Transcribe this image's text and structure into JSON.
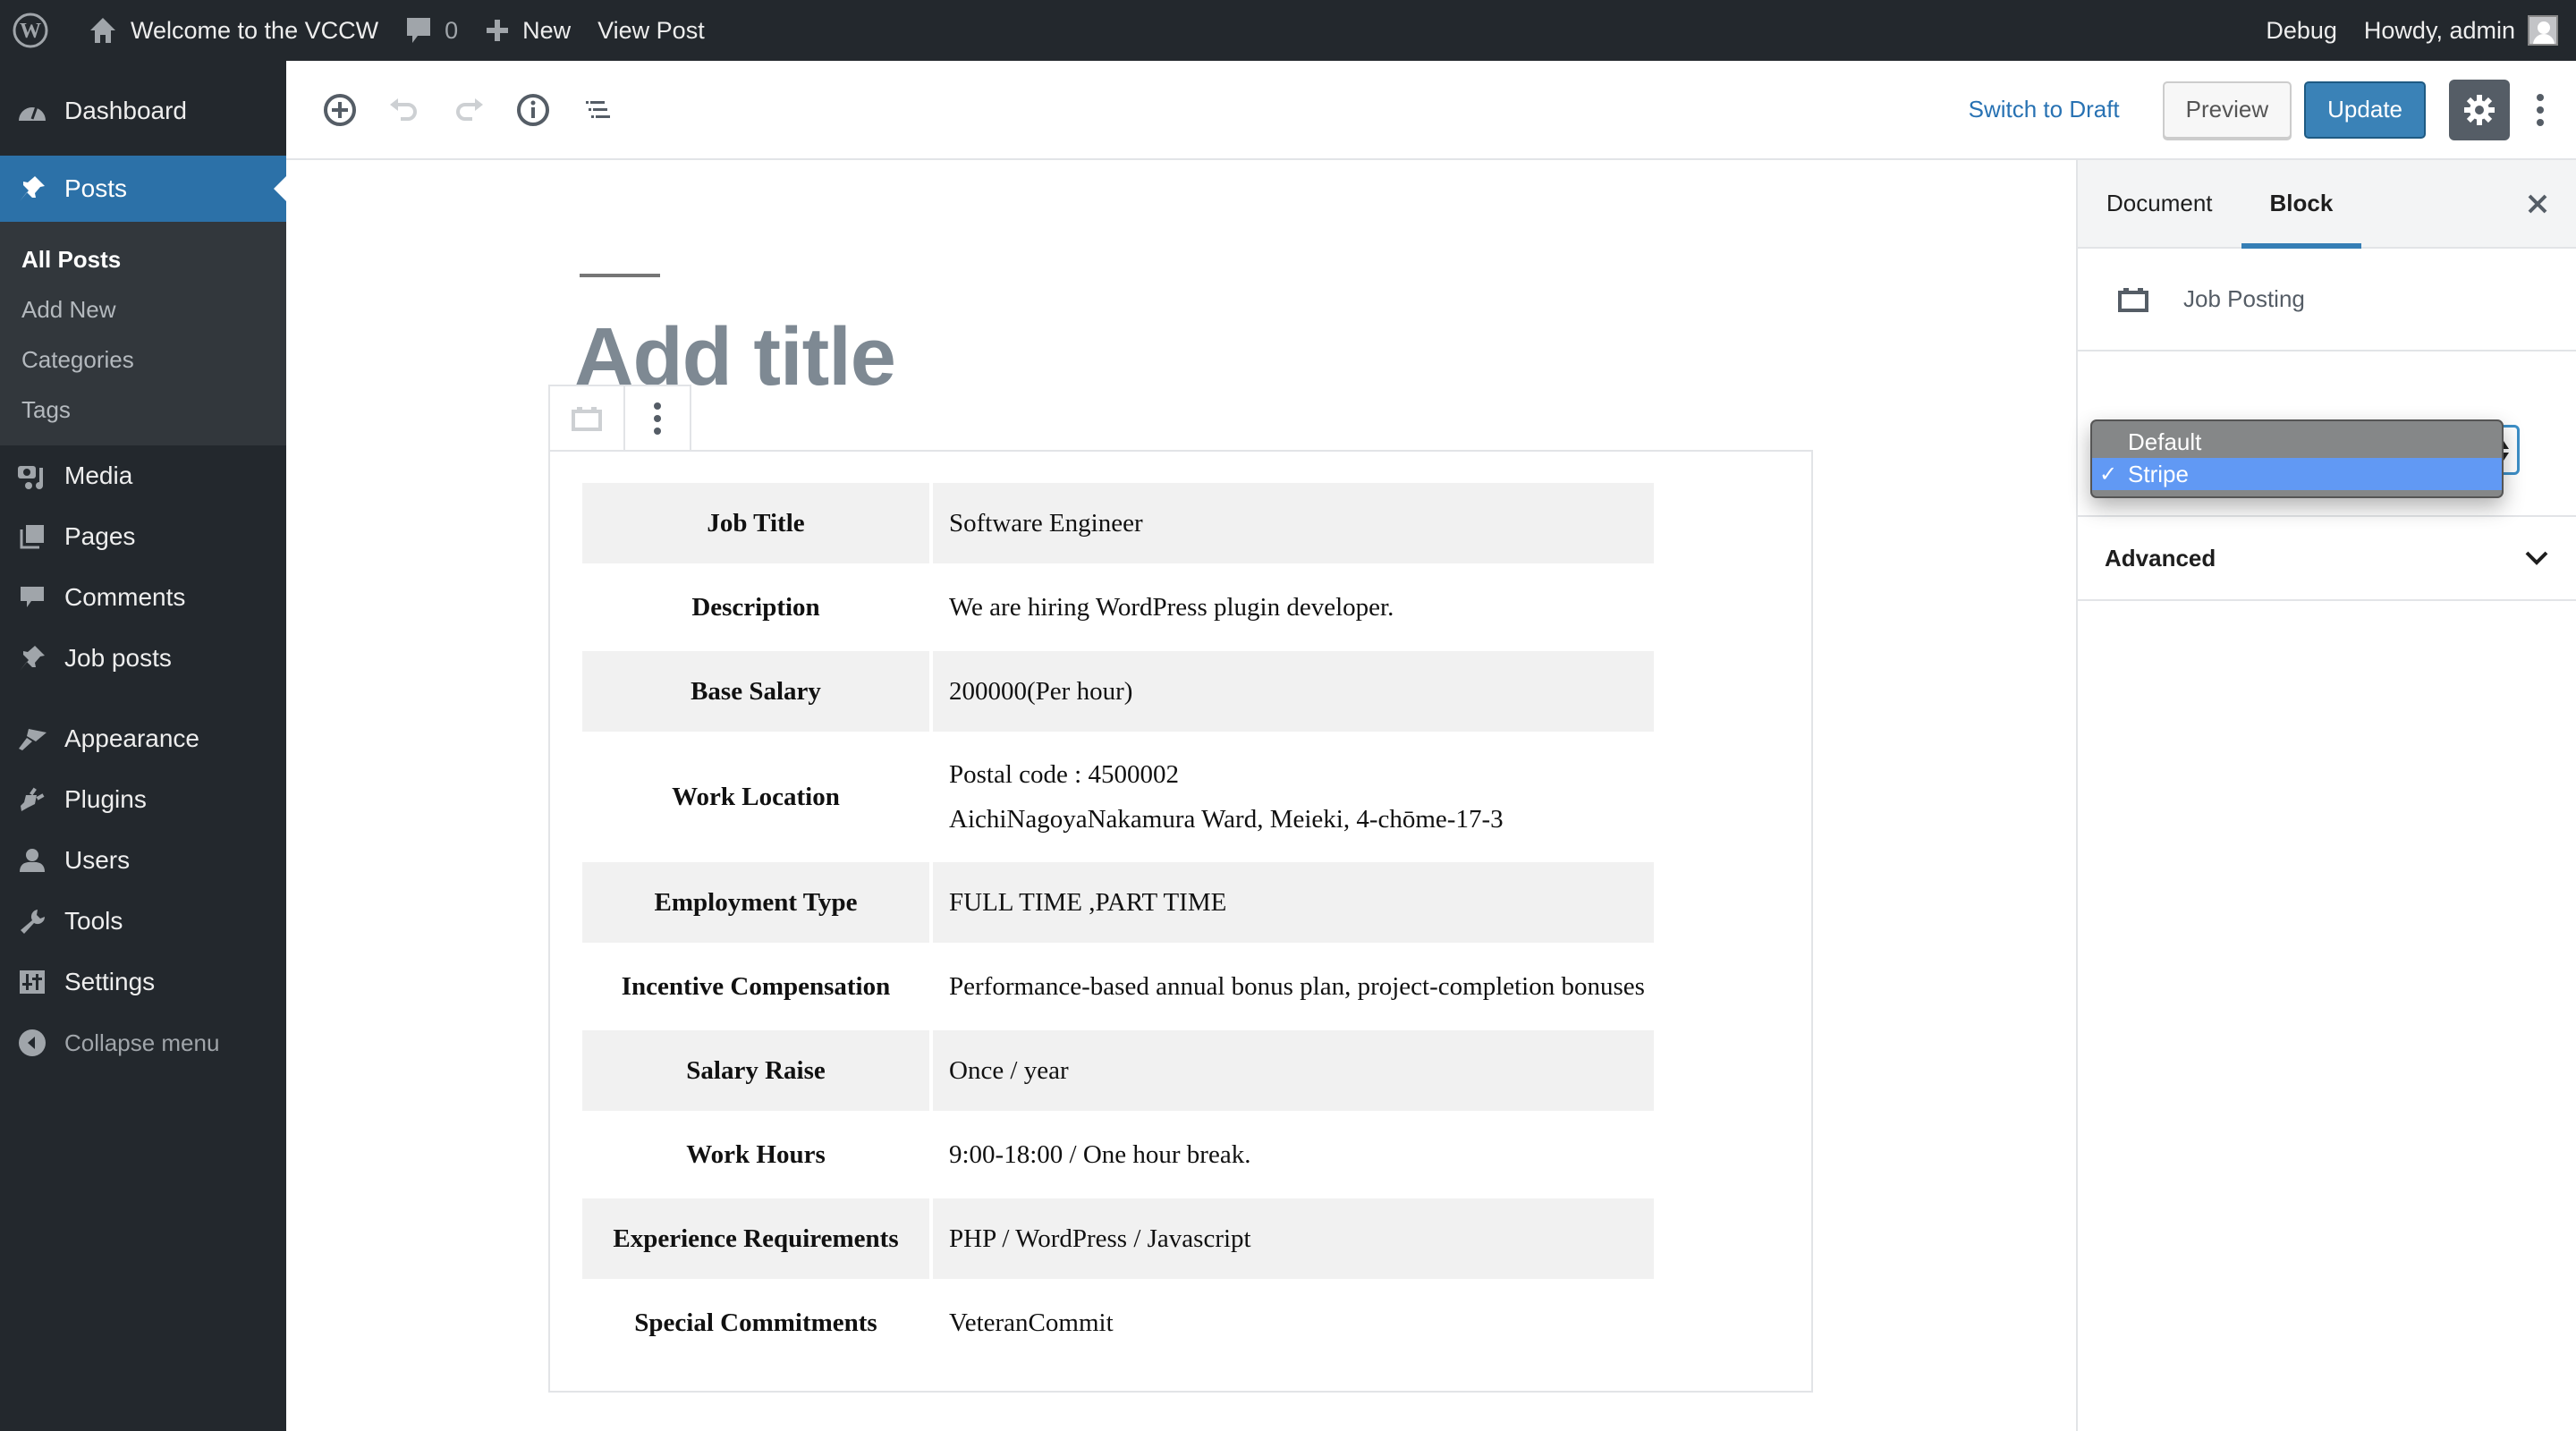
{
  "adminbar": {
    "site_name": "Welcome to the VCCW",
    "comments_count": "0",
    "new_label": "New",
    "view_post_label": "View Post",
    "debug_label": "Debug",
    "howdy_label": "Howdy, admin"
  },
  "sidebar": {
    "dashboard": "Dashboard",
    "posts": "Posts",
    "posts_sub": [
      "All Posts",
      "Add New",
      "Categories",
      "Tags"
    ],
    "media": "Media",
    "pages": "Pages",
    "comments": "Comments",
    "job_posts": "Job posts",
    "appearance": "Appearance",
    "plugins": "Plugins",
    "users": "Users",
    "tools": "Tools",
    "settings": "Settings",
    "collapse": "Collapse menu"
  },
  "header": {
    "switch_to_draft": "Switch to Draft",
    "preview": "Preview",
    "update": "Update"
  },
  "editor": {
    "title_placeholder": "Add title",
    "table": [
      {
        "label": "Job Title",
        "value": [
          "Software Engineer"
        ]
      },
      {
        "label": "Description",
        "value": [
          "We are hiring WordPress plugin developer."
        ]
      },
      {
        "label": "Base Salary",
        "value": [
          "200000(Per hour)"
        ]
      },
      {
        "label": "Work Location",
        "value": [
          "Postal code : 4500002",
          "AichiNagoyaNakamura Ward, Meieki, 4-chōme-17-3"
        ]
      },
      {
        "label": "Employment Type",
        "value": [
          "FULL TIME ,PART TIME"
        ]
      },
      {
        "label": "Incentive Compensation",
        "value": [
          "Performance-based annual bonus plan, project-completion bonuses"
        ]
      },
      {
        "label": "Salary Raise",
        "value": [
          "Once / year"
        ]
      },
      {
        "label": "Work Hours",
        "value": [
          "9:00-18:00 / One hour break."
        ]
      },
      {
        "label": "Experience Requirements",
        "value": [
          "PHP / WordPress / Javascript"
        ]
      },
      {
        "label": "Special Commitments",
        "value": [
          "VeteranCommit"
        ]
      }
    ]
  },
  "panel": {
    "tabs": [
      "Document",
      "Block"
    ],
    "active_tab": "Block",
    "block_name": "Job Posting",
    "style_options": [
      "Default",
      "Stripe"
    ],
    "style_selected": "Stripe",
    "advanced_label": "Advanced"
  },
  "colors": {
    "admin_bg": "#23282d",
    "accent": "#2c71a8",
    "primary_button": "#3a82b7",
    "dropdown_highlight": "#6199f4",
    "stripe_row": "#f1f1f1"
  }
}
